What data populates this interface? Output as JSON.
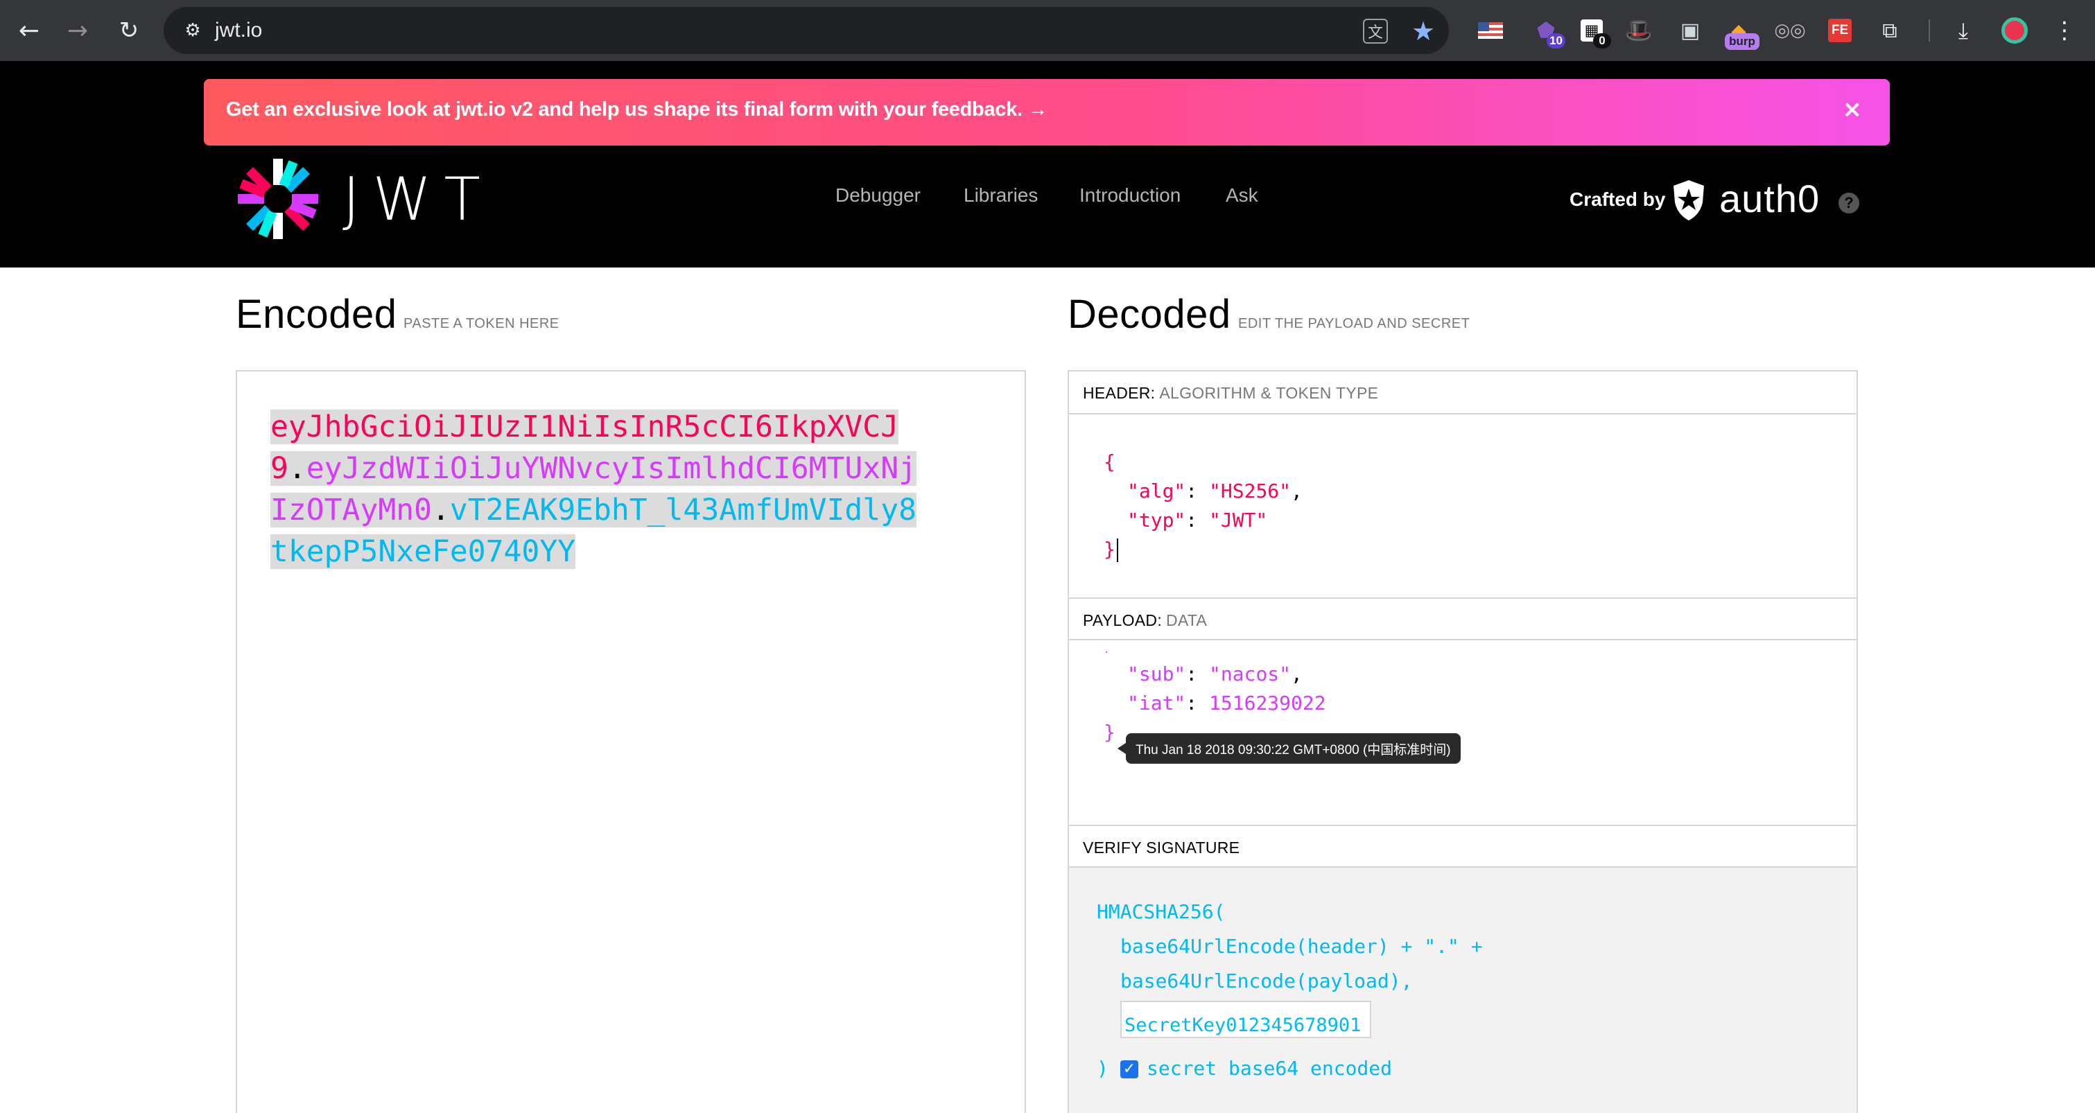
{
  "browser": {
    "url": "jwt.io",
    "extensions": [
      {
        "name": "flag-us-icon"
      },
      {
        "name": "extension-10-icon",
        "badge": "10"
      },
      {
        "name": "extension-0-icon",
        "badge": "0"
      },
      {
        "name": "hat-icon"
      },
      {
        "name": "extension-green-icon"
      },
      {
        "name": "burp-extension-icon",
        "badge": "burp"
      },
      {
        "name": "glasses-icon"
      },
      {
        "name": "fe-extension-icon",
        "label": "FE"
      },
      {
        "name": "puzzle-icon"
      }
    ]
  },
  "banner": {
    "text": "Get an exclusive look at jwt.io v2 and help us shape its final form with your feedback. →",
    "close": "×"
  },
  "header": {
    "logo_text": "JWT",
    "nav": [
      "Debugger",
      "Libraries",
      "Introduction",
      "Ask"
    ],
    "crafted_by": "Crafted by",
    "brand": "auth0",
    "help": "?"
  },
  "encoded": {
    "title": "Encoded",
    "subtitle": "PASTE A TOKEN HERE",
    "token_header": "eyJhbGciOiJIUzI1NiIsInR5cCI6IkpXVCJ9",
    "token_payload": "eyJzdWIiOiJuYWNvcyIsImlhdCI6MTUxNjIzOTAyMn0",
    "token_signature": "vT2EAK9EbhT_l43AmfUmVIdly8tkepP5NxeFe0740YY",
    "dot": "."
  },
  "decoded": {
    "title": "Decoded",
    "subtitle": "EDIT THE PAYLOAD AND SECRET",
    "header_section": {
      "label": "HEADER:",
      "sublabel": "ALGORITHM & TOKEN TYPE"
    },
    "header_json": {
      "alg": "HS256",
      "typ": "JWT"
    },
    "payload_section": {
      "label": "PAYLOAD:",
      "sublabel": "DATA"
    },
    "payload_json": {
      "sub": "nacos",
      "iat": "1516239022"
    },
    "iat_tooltip": "Thu Jan 18 2018 09:30:22 GMT+0800 (中国标准时间)",
    "verify_section": {
      "label": "VERIFY SIGNATURE"
    },
    "verify": {
      "line1": "HMACSHA256(",
      "line2": "base64UrlEncode(header) + \".\" +",
      "line3": "base64UrlEncode(payload),",
      "secret": "SecretKey012345678901",
      "close": ")",
      "checkbox_label": "secret base64 encoded",
      "checkbox_checked": true
    }
  },
  "colors": {
    "header_token": "#fb015b",
    "payload_token": "#d63aff",
    "signature_token": "#00b9f1"
  }
}
